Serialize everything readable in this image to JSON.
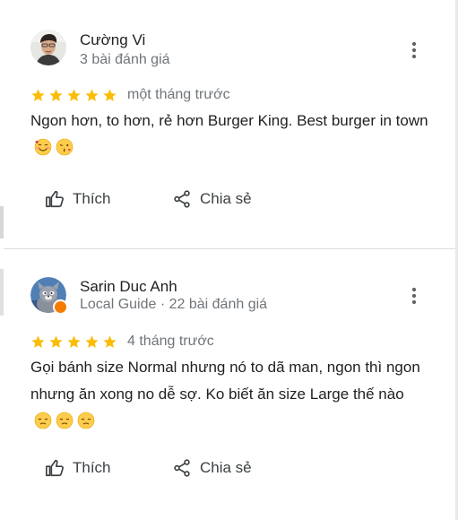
{
  "reviews": [
    {
      "author_name": "Cường Vi",
      "meta": "3 bài đánh giá",
      "rating": 5,
      "time": "một tháng trước",
      "text": "Ngon hơn, to hơn, rẻ hơn Burger King. Best burger in town",
      "emojis": [
        "smiling-face-with-hearts",
        "face-blowing-a-kiss"
      ],
      "like_label": "Thích",
      "share_label": "Chia sẻ"
    },
    {
      "author_name": "Sarin Duc Anh",
      "meta": "Local Guide · 22 bài đánh giá",
      "rating": 5,
      "time": "4 tháng trước",
      "text": "Gọi bánh size Normal nhưng nó to dã man, ngon thì ngon nhưng ăn xong no dễ sợ. Ko biết ăn size Large thế nào",
      "emojis": [
        "downcast-face",
        "downcast-face",
        "downcast-face"
      ],
      "like_label": "Thích",
      "share_label": "Chia sẻ"
    }
  ],
  "colors": {
    "star": "#fbbc04",
    "secondary_text": "#70757a",
    "divider": "#dadce0",
    "local_guide_badge": "#f57c00"
  },
  "icons": {
    "more": "more-vert-icon",
    "like": "thumb-up-icon",
    "share": "share-icon",
    "star": "star-icon"
  }
}
